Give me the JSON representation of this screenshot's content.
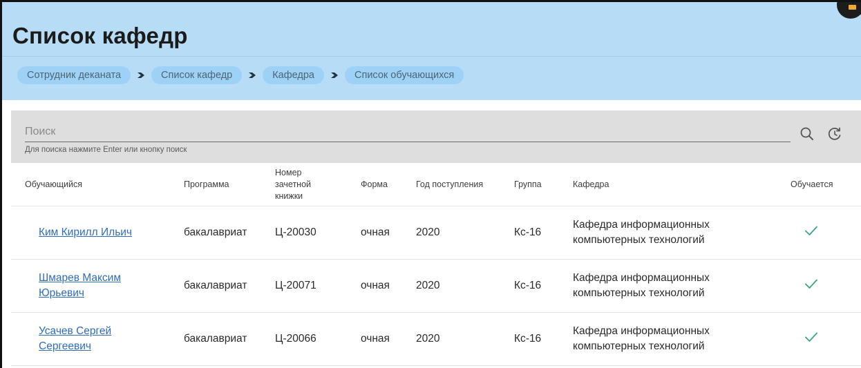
{
  "page": {
    "title": "Список кафедр"
  },
  "breadcrumb": [
    {
      "label": "Сотрудник деканата"
    },
    {
      "label": "Список кафедр"
    },
    {
      "label": "Кафедра"
    },
    {
      "label": "Список обучающихся"
    }
  ],
  "search": {
    "placeholder": "Поиск",
    "hint": "Для поиска нажмите Enter или кнопку поиск"
  },
  "icons": {
    "search": "search-icon",
    "refresh": "refresh-icon",
    "breadcrumb_separator": "chevron-right-icon",
    "active": "checkmark-icon"
  },
  "colors": {
    "header_bg": "#b7dcf6",
    "crumb_bg": "#9dd2f6",
    "search_bg": "#dedede",
    "link": "#2f6db8",
    "check": "#3aa57a"
  },
  "table": {
    "columns": [
      "Обучающийся",
      "Программа",
      "Номер зачетной книжки",
      "Форма",
      "Год поступления",
      "Группа",
      "Кафедра",
      "Обучается"
    ],
    "rows": [
      {
        "name": "Ким Кирилл Ильич",
        "program": "бакалавриат",
        "record": "Ц-20030",
        "form": "очная",
        "year": "2020",
        "group": "Кс-16",
        "department": "Кафедра информационных компьютерных технологий",
        "active": true
      },
      {
        "name": "Шмарев Максим Юрьевич",
        "program": "бакалавриат",
        "record": "Ц-20071",
        "form": "очная",
        "year": "2020",
        "group": "Кс-16",
        "department": "Кафедра информационных компьютерных технологий",
        "active": true
      },
      {
        "name": "Усачев Сергей Сергеевич",
        "program": "бакалавриат",
        "record": "Ц-20066",
        "form": "очная",
        "year": "2020",
        "group": "Кс-16",
        "department": "Кафедра информационных компьютерных технологий",
        "active": true
      }
    ]
  }
}
